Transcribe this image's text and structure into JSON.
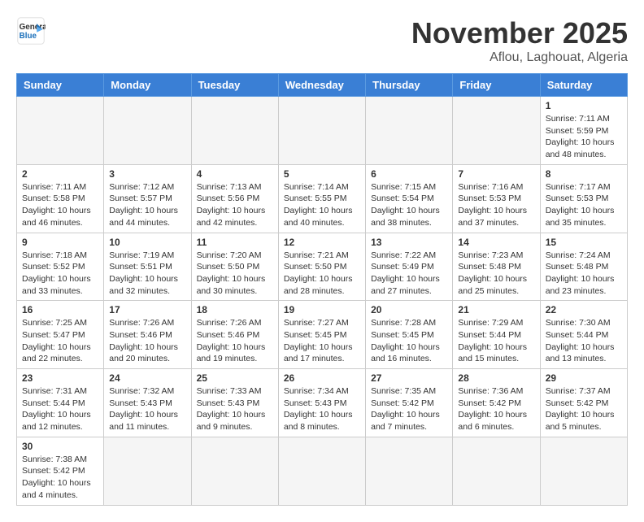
{
  "logo": {
    "line1": "General",
    "line2": "Blue"
  },
  "title": "November 2025",
  "subtitle": "Aflou, Laghouat, Algeria",
  "weekdays": [
    "Sunday",
    "Monday",
    "Tuesday",
    "Wednesday",
    "Thursday",
    "Friday",
    "Saturday"
  ],
  "weeks": [
    [
      {
        "day": "",
        "empty": true
      },
      {
        "day": "",
        "empty": true
      },
      {
        "day": "",
        "empty": true
      },
      {
        "day": "",
        "empty": true
      },
      {
        "day": "",
        "empty": true
      },
      {
        "day": "",
        "empty": true
      },
      {
        "day": "1",
        "sunrise": "7:11 AM",
        "sunset": "5:59 PM",
        "daylight": "10 hours and 48 minutes."
      }
    ],
    [
      {
        "day": "2",
        "sunrise": "7:11 AM",
        "sunset": "5:58 PM",
        "daylight": "10 hours and 46 minutes."
      },
      {
        "day": "3",
        "sunrise": "7:12 AM",
        "sunset": "5:57 PM",
        "daylight": "10 hours and 44 minutes."
      },
      {
        "day": "4",
        "sunrise": "7:13 AM",
        "sunset": "5:56 PM",
        "daylight": "10 hours and 42 minutes."
      },
      {
        "day": "5",
        "sunrise": "7:14 AM",
        "sunset": "5:55 PM",
        "daylight": "10 hours and 40 minutes."
      },
      {
        "day": "6",
        "sunrise": "7:15 AM",
        "sunset": "5:54 PM",
        "daylight": "10 hours and 38 minutes."
      },
      {
        "day": "7",
        "sunrise": "7:16 AM",
        "sunset": "5:53 PM",
        "daylight": "10 hours and 37 minutes."
      },
      {
        "day": "8",
        "sunrise": "7:17 AM",
        "sunset": "5:53 PM",
        "daylight": "10 hours and 35 minutes."
      }
    ],
    [
      {
        "day": "9",
        "sunrise": "7:18 AM",
        "sunset": "5:52 PM",
        "daylight": "10 hours and 33 minutes."
      },
      {
        "day": "10",
        "sunrise": "7:19 AM",
        "sunset": "5:51 PM",
        "daylight": "10 hours and 32 minutes."
      },
      {
        "day": "11",
        "sunrise": "7:20 AM",
        "sunset": "5:50 PM",
        "daylight": "10 hours and 30 minutes."
      },
      {
        "day": "12",
        "sunrise": "7:21 AM",
        "sunset": "5:50 PM",
        "daylight": "10 hours and 28 minutes."
      },
      {
        "day": "13",
        "sunrise": "7:22 AM",
        "sunset": "5:49 PM",
        "daylight": "10 hours and 27 minutes."
      },
      {
        "day": "14",
        "sunrise": "7:23 AM",
        "sunset": "5:48 PM",
        "daylight": "10 hours and 25 minutes."
      },
      {
        "day": "15",
        "sunrise": "7:24 AM",
        "sunset": "5:48 PM",
        "daylight": "10 hours and 23 minutes."
      }
    ],
    [
      {
        "day": "16",
        "sunrise": "7:25 AM",
        "sunset": "5:47 PM",
        "daylight": "10 hours and 22 minutes."
      },
      {
        "day": "17",
        "sunrise": "7:26 AM",
        "sunset": "5:46 PM",
        "daylight": "10 hours and 20 minutes."
      },
      {
        "day": "18",
        "sunrise": "7:26 AM",
        "sunset": "5:46 PM",
        "daylight": "10 hours and 19 minutes."
      },
      {
        "day": "19",
        "sunrise": "7:27 AM",
        "sunset": "5:45 PM",
        "daylight": "10 hours and 17 minutes."
      },
      {
        "day": "20",
        "sunrise": "7:28 AM",
        "sunset": "5:45 PM",
        "daylight": "10 hours and 16 minutes."
      },
      {
        "day": "21",
        "sunrise": "7:29 AM",
        "sunset": "5:44 PM",
        "daylight": "10 hours and 15 minutes."
      },
      {
        "day": "22",
        "sunrise": "7:30 AM",
        "sunset": "5:44 PM",
        "daylight": "10 hours and 13 minutes."
      }
    ],
    [
      {
        "day": "23",
        "sunrise": "7:31 AM",
        "sunset": "5:44 PM",
        "daylight": "10 hours and 12 minutes."
      },
      {
        "day": "24",
        "sunrise": "7:32 AM",
        "sunset": "5:43 PM",
        "daylight": "10 hours and 11 minutes."
      },
      {
        "day": "25",
        "sunrise": "7:33 AM",
        "sunset": "5:43 PM",
        "daylight": "10 hours and 9 minutes."
      },
      {
        "day": "26",
        "sunrise": "7:34 AM",
        "sunset": "5:43 PM",
        "daylight": "10 hours and 8 minutes."
      },
      {
        "day": "27",
        "sunrise": "7:35 AM",
        "sunset": "5:42 PM",
        "daylight": "10 hours and 7 minutes."
      },
      {
        "day": "28",
        "sunrise": "7:36 AM",
        "sunset": "5:42 PM",
        "daylight": "10 hours and 6 minutes."
      },
      {
        "day": "29",
        "sunrise": "7:37 AM",
        "sunset": "5:42 PM",
        "daylight": "10 hours and 5 minutes."
      }
    ],
    [
      {
        "day": "30",
        "sunrise": "7:38 AM",
        "sunset": "5:42 PM",
        "daylight": "10 hours and 4 minutes."
      },
      {
        "day": "",
        "empty": true
      },
      {
        "day": "",
        "empty": true
      },
      {
        "day": "",
        "empty": true
      },
      {
        "day": "",
        "empty": true
      },
      {
        "day": "",
        "empty": true
      },
      {
        "day": "",
        "empty": true
      }
    ]
  ]
}
